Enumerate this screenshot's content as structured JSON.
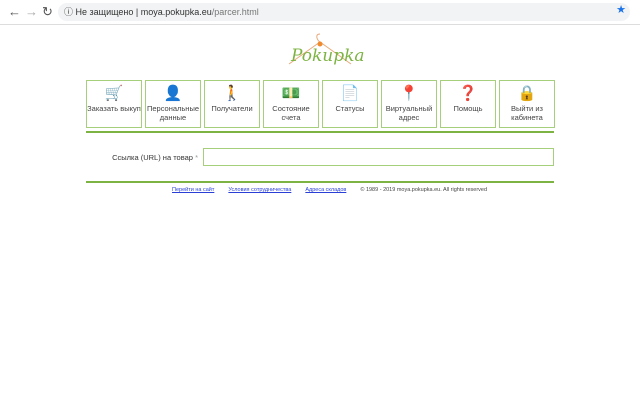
{
  "browser": {
    "security": "Не защищено",
    "domain": "moya.pokupka.eu",
    "path": "/parcer.html"
  },
  "logo": {
    "text": "Pokupka"
  },
  "menu": [
    {
      "label": "Заказать выкуп",
      "icon": "cart-icon",
      "glyph": "🛒"
    },
    {
      "label": "Персональные данные",
      "icon": "user-list-icon",
      "glyph": "👤"
    },
    {
      "label": "Получатели",
      "icon": "recipient-icon",
      "glyph": "🚶"
    },
    {
      "label": "Состояние счета",
      "icon": "money-icon",
      "glyph": "💵"
    },
    {
      "label": "Статусы",
      "icon": "documents-icon",
      "glyph": "📄"
    },
    {
      "label": "Виртуальный адрес",
      "icon": "map-pin-icon",
      "glyph": "📍"
    },
    {
      "label": "Помощь",
      "icon": "help-icon",
      "glyph": "❓"
    },
    {
      "label": "Выйти из кабинета",
      "icon": "lock-icon",
      "glyph": "🔒"
    }
  ],
  "form": {
    "label": "Ссылка (URL) на товар",
    "required": "*",
    "value": ""
  },
  "footer": {
    "links": [
      "Перейти на сайт",
      "Условия сотрудничества",
      "Адреса складов"
    ],
    "copyright": "© 1989 - 2019 moya.pokupka.eu. All rights reserved"
  }
}
